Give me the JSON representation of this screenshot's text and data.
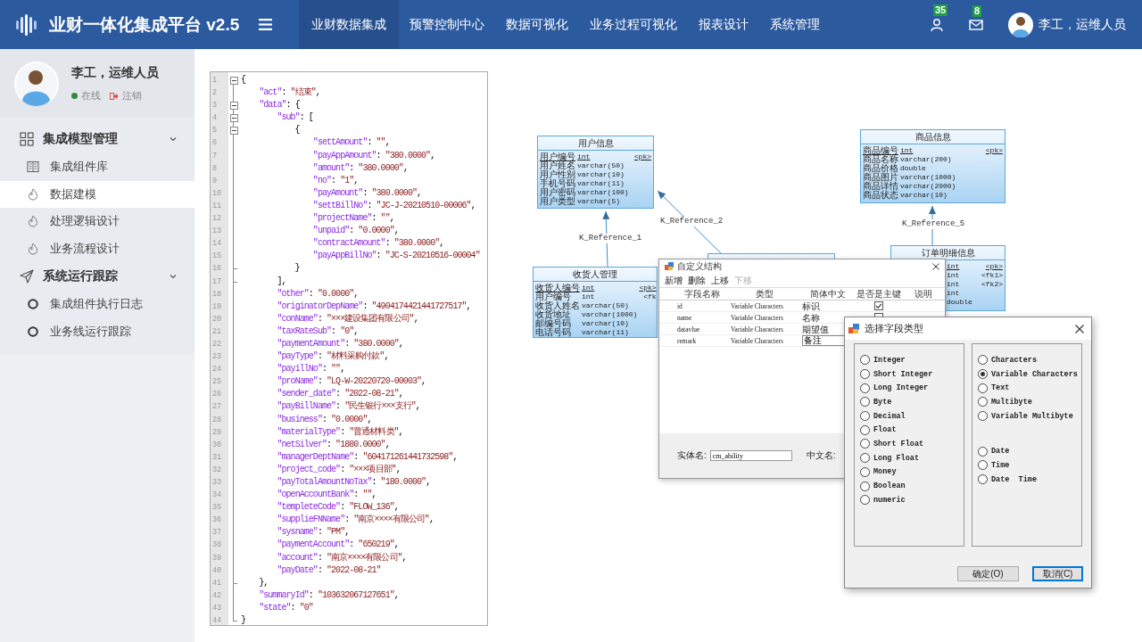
{
  "header": {
    "title": "业财一体化集成平台 v2.5",
    "nav": [
      {
        "label": "业财数据集成",
        "selected": true
      },
      {
        "label": "预警控制中心",
        "selected": false
      },
      {
        "label": "数据可视化",
        "selected": false
      },
      {
        "label": "业务过程可视化",
        "selected": false
      },
      {
        "label": "报表设计",
        "selected": false
      },
      {
        "label": "系统管理",
        "selected": false
      }
    ],
    "notifications": [
      {
        "kind": "users",
        "count": "35"
      },
      {
        "kind": "mail",
        "count": "8"
      }
    ],
    "user": "李工，运维人员"
  },
  "sidebar": {
    "profile": {
      "name": "李工，运维人员",
      "status": "在线",
      "online": true,
      "logout": "注销"
    },
    "groups": [
      {
        "label": "集成模型管理",
        "expanded": true,
        "items": [
          {
            "label": "集成组件库",
            "selected": false
          },
          {
            "label": "数据建模",
            "selected": true
          },
          {
            "label": "处理逻辑设计",
            "selected": false
          },
          {
            "label": "业务流程设计",
            "selected": false
          }
        ]
      },
      {
        "label": "系统运行跟踪",
        "expanded": true,
        "items": [
          {
            "label": "集成组件执行日志",
            "selected": false
          },
          {
            "label": "业务线运行跟踪",
            "selected": false
          }
        ]
      }
    ]
  },
  "editor": {
    "lines": [
      {
        "number": "1",
        "kind": "open",
        "code": "{"
      },
      {
        "number": "2",
        "kind": "plain",
        "code": "    \"act\": \"结束\","
      },
      {
        "number": "3",
        "kind": "open",
        "code": "    \"data\": {"
      },
      {
        "number": "4",
        "kind": "open",
        "code": "        \"sub\": ["
      },
      {
        "number": "5",
        "kind": "open",
        "code": "            {"
      },
      {
        "number": "6",
        "kind": "plain",
        "code": "                \"settAmount\": \"\","
      },
      {
        "number": "7",
        "kind": "plain",
        "code": "                \"payAppAmount\": \"380.0000\","
      },
      {
        "number": "8",
        "kind": "plain",
        "code": "                \"amount\": \"380.0000\","
      },
      {
        "number": "9",
        "kind": "plain",
        "code": "                \"no\": \"1\","
      },
      {
        "number": "10",
        "kind": "plain",
        "code": "                \"payAmount\": \"380.0000\","
      },
      {
        "number": "11",
        "kind": "plain",
        "code": "                \"settBillNo\": \"JC-J-20210510-00006\","
      },
      {
        "number": "12",
        "kind": "plain",
        "code": "                \"projectName\": \"\","
      },
      {
        "number": "13",
        "kind": "plain",
        "code": "                \"unpaid\": \"0.0000\","
      },
      {
        "number": "14",
        "kind": "plain",
        "code": "                \"contractAmount\": \"380.0000\","
      },
      {
        "number": "15",
        "kind": "plain",
        "code": "                \"payAppBillNo\": \"JC-S-20210516-00004\""
      },
      {
        "number": "16",
        "kind": "close",
        "code": "            }"
      },
      {
        "number": "17",
        "kind": "close",
        "code": "        ],"
      },
      {
        "number": "18",
        "kind": "plain",
        "code": "        \"other\": \"0.0000\","
      },
      {
        "number": "19",
        "kind": "plain",
        "code": "        \"originatorDepName\": \"4904174421441727517\","
      },
      {
        "number": "20",
        "kind": "plain",
        "code": "        \"conName\": \"×××建设集团有限公司\","
      },
      {
        "number": "21",
        "kind": "plain",
        "code": "        \"taxRateSub\": \"0\","
      },
      {
        "number": "22",
        "kind": "plain",
        "code": "        \"paymentAmount\": \"380.0000\","
      },
      {
        "number": "23",
        "kind": "plain",
        "code": "        \"payType\": \"材料采购付款\","
      },
      {
        "number": "24",
        "kind": "plain",
        "code": "        \"payillNo\": \"\","
      },
      {
        "number": "25",
        "kind": "plain",
        "code": "        \"proName\": \"LQ-W-20220720-00003\","
      },
      {
        "number": "26",
        "kind": "plain",
        "code": "        \"sender_date\": \"2022-08-21\","
      },
      {
        "number": "27",
        "kind": "plain",
        "code": "        \"payBillName\": \"民生银行×××支行\","
      },
      {
        "number": "28",
        "kind": "plain",
        "code": "        \"business\": \"0.0000\","
      },
      {
        "number": "29",
        "kind": "plain",
        "code": "        \"materialType\": \"普通材料类\","
      },
      {
        "number": "30",
        "kind": "plain",
        "code": "        \"netSilver\": \"1880.0000\","
      },
      {
        "number": "31",
        "kind": "plain",
        "code": "        \"managerDeptName\": \"604171261441732598\","
      },
      {
        "number": "32",
        "kind": "plain",
        "code": "        \"project_code\": \"×××项目部\","
      },
      {
        "number": "33",
        "kind": "plain",
        "code": "        \"payTotalAmountNoTax\": \"180.0000\","
      },
      {
        "number": "34",
        "kind": "plain",
        "code": "        \"openAccountBank\": \"\","
      },
      {
        "number": "35",
        "kind": "plain",
        "code": "        \"templeteCode\": \"FLOW_136\","
      },
      {
        "number": "36",
        "kind": "plain",
        "code": "        \"supplieFNName\": \"南京××××有限公司\","
      },
      {
        "number": "37",
        "kind": "plain",
        "code": "        \"sysname\": \"PM\","
      },
      {
        "number": "38",
        "kind": "plain",
        "code": "        \"paymentAccount\": \"650219\","
      },
      {
        "number": "39",
        "kind": "plain",
        "code": "        \"account\": \"南京××××有限公司\","
      },
      {
        "number": "40",
        "kind": "plain",
        "code": "        \"payDate\": \"2022-08-21\""
      },
      {
        "number": "41",
        "kind": "close",
        "code": "    },"
      },
      {
        "number": "42",
        "kind": "plain",
        "code": "    \"summaryId\": \"103632067127651\","
      },
      {
        "number": "43",
        "kind": "plain",
        "code": "    \"state\": \"0\""
      },
      {
        "number": "44",
        "kind": "close",
        "code": "}"
      }
    ]
  },
  "diagram": {
    "entities": [
      {
        "kind": "table",
        "title": "用户信息",
        "rows": [
          {
            "name": "用户编号",
            "type": "int",
            "key": "<pk>",
            "primary": true
          },
          {
            "name": "用户姓名",
            "type": "varchar(50)",
            "primary": false
          },
          {
            "name": "用户性别",
            "type": "varchar(10)",
            "primary": false
          },
          {
            "name": "手机号码",
            "type": "varchar(11)",
            "primary": false
          },
          {
            "name": "用户密码",
            "type": "varchar(100)",
            "primary": false
          },
          {
            "name": "用户类型",
            "type": "varchar(5)",
            "primary": false
          }
        ]
      },
      {
        "kind": "table",
        "title": "商品信息",
        "rows": [
          {
            "name": "商品编号",
            "type": "int",
            "key": "<pk>",
            "primary": true
          },
          {
            "name": "商品名称",
            "type": "varchar(200)",
            "primary": false
          },
          {
            "name": "商品价格",
            "type": "double",
            "primary": false
          },
          {
            "name": "商品图片",
            "type": "varchar(1000)",
            "primary": false
          },
          {
            "name": "商品详情",
            "type": "varchar(2000)",
            "primary": false
          },
          {
            "name": "商品状态",
            "type": "varchar(10)",
            "primary": false
          }
        ]
      },
      {
        "kind": "covered"
      },
      {
        "kind": "table",
        "title": "订单明细信息",
        "rows": [
          {
            "type": "int",
            "key": "<pk>",
            "primary": true
          },
          {
            "type": "int",
            "key": "<fk1>",
            "primary": false
          },
          {
            "type": "int",
            "key": "<fk2>",
            "primary": false
          },
          {
            "type": "int",
            "primary": false
          },
          {
            "type": "double",
            "primary": false
          }
        ]
      },
      {
        "kind": "table",
        "title": "收货人管理",
        "rows": [
          {
            "name": "收货人编号",
            "type": "int",
            "key": "<pk>",
            "primary": true
          },
          {
            "name": "用户编号",
            "type": "int",
            "key": "<fk",
            "primary": false
          },
          {
            "name": "收货人姓名",
            "type": "varchar(50)",
            "primary": false
          },
          {
            "name": "收货地址",
            "type": "varchar(1000)",
            "primary": false
          },
          {
            "name": "邮编号码",
            "type": "varchar(10)",
            "primary": false
          },
          {
            "name": "电话号码",
            "type": "varchar(11)",
            "primary": false
          }
        ]
      }
    ],
    "references": [
      {
        "label": "K_Reference_1"
      },
      {
        "label": "K_Reference_2"
      },
      {
        "label": "K_Reference_5"
      }
    ],
    "structure_dialog": {
      "title": "自定义结构",
      "toolbar": [
        {
          "label": "新增",
          "disabled": false
        },
        {
          "label": "删除",
          "disabled": false
        },
        {
          "label": "上移",
          "disabled": false
        },
        {
          "label": "下移",
          "disabled": true
        }
      ],
      "columns": [
        "字段名称",
        "类型",
        "简体中文",
        "是否是主键",
        "说明"
      ],
      "rows": [
        {
          "name": "id",
          "type": "Variable Characters",
          "cn": "标识",
          "editing": false,
          "primary_key": true
        },
        {
          "name": "name",
          "type": "Variable Characters",
          "cn": "名称",
          "editing": false,
          "primary_key": false
        },
        {
          "name": "datavlue",
          "type": "Variable Characters",
          "cn": "期望值",
          "editing": false
        },
        {
          "name": "remark",
          "type": "Variable Characters",
          "cn": "备注",
          "editing": true
        }
      ],
      "entity_label": "实体名:",
      "entity_value": "cm_ability",
      "cn_label": "中文名:"
    },
    "type_dialog": {
      "title": "选择字段类型",
      "columns": [
        {
          "sections": [
            {
              "options": [
                {
                  "label": "Integer",
                  "selected": false
                },
                {
                  "label": "Short Integer",
                  "selected": false
                },
                {
                  "label": "Long Integer",
                  "selected": false
                },
                {
                  "label": "Byte",
                  "selected": false
                },
                {
                  "label": "Decimal",
                  "selected": false
                },
                {
                  "label": "Float",
                  "selected": false
                },
                {
                  "label": "Short Float",
                  "selected": false
                },
                {
                  "label": "Long Float",
                  "selected": false
                },
                {
                  "label": "Money",
                  "selected": false
                },
                {
                  "label": "Boolean",
                  "selected": false
                },
                {
                  "label": "numeric",
                  "selected": false
                }
              ]
            }
          ]
        },
        {
          "sections": [
            {
              "options": [
                {
                  "label": "Characters",
                  "selected": false
                },
                {
                  "label": "Variable Characters",
                  "selected": true
                },
                {
                  "label": "Text",
                  "selected": false
                },
                {
                  "label": "Multibyte",
                  "selected": false
                },
                {
                  "label": "Variable Multibyte",
                  "selected": false
                }
              ]
            },
            {
              "options": [
                {
                  "label": "Date",
                  "selected": false
                },
                {
                  "label": "Time",
                  "selected": false
                },
                {
                  "label": "Date  Time",
                  "selected": false
                }
              ]
            }
          ]
        }
      ],
      "buttons": [
        {
          "label": "确定(O)",
          "focused": false
        },
        {
          "label": "取消(C)",
          "focused": true
        }
      ]
    }
  }
}
